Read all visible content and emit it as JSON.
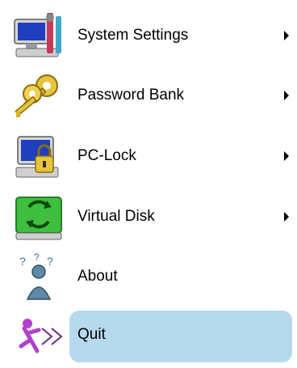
{
  "menu": {
    "items": [
      {
        "label": "System Settings",
        "icon": "system-settings-icon",
        "has_submenu": true,
        "highlighted": false
      },
      {
        "label": "Password Bank",
        "icon": "password-bank-keys-icon",
        "has_submenu": true,
        "highlighted": false
      },
      {
        "label": "PC-Lock",
        "icon": "pc-lock-icon",
        "has_submenu": true,
        "highlighted": false
      },
      {
        "label": "Virtual Disk",
        "icon": "virtual-disk-icon",
        "has_submenu": true,
        "highlighted": false
      },
      {
        "label": "About",
        "icon": "about-icon",
        "has_submenu": false,
        "highlighted": false
      },
      {
        "label": "Quit",
        "icon": "quit-icon",
        "has_submenu": false,
        "highlighted": true
      }
    ],
    "colors": {
      "highlight": "#b7d9ee",
      "text": "#000000"
    }
  }
}
